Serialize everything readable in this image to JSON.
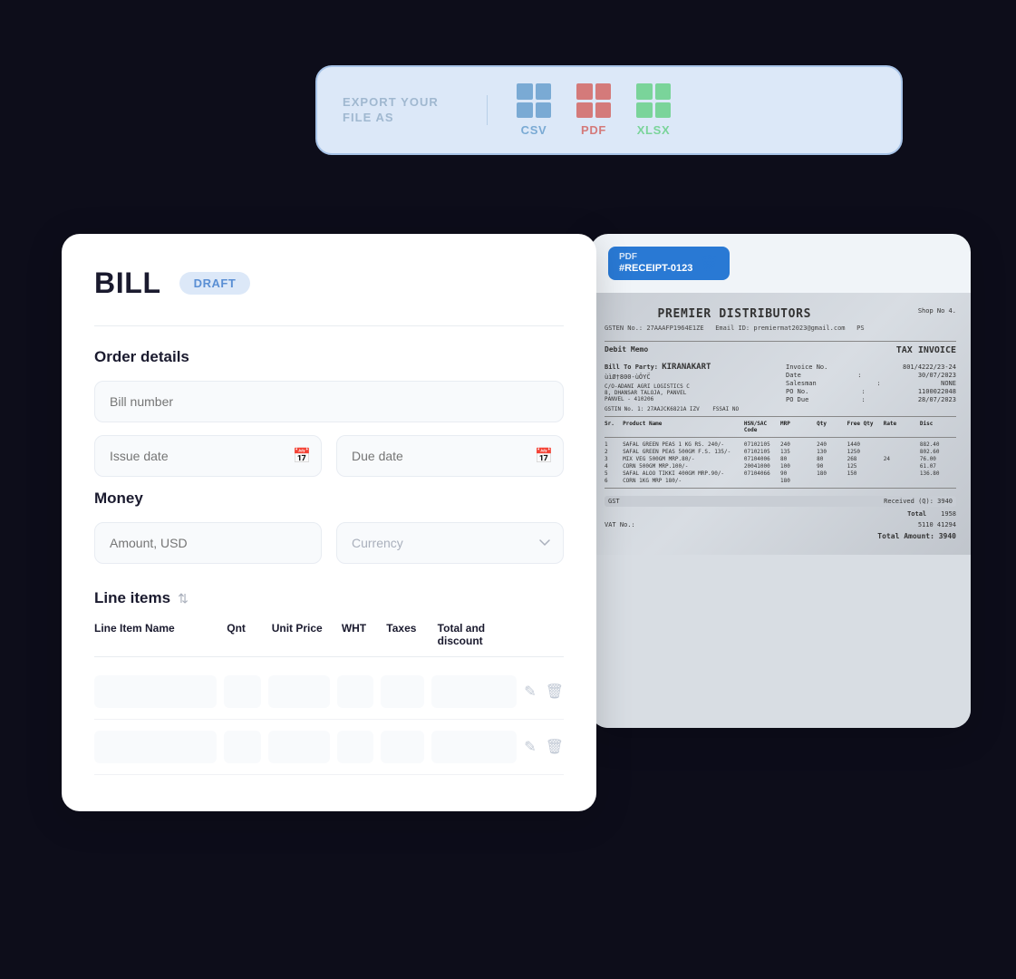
{
  "export": {
    "label": "EXPORT YOUR\nFILE AS",
    "options": [
      {
        "id": "csv",
        "label": "CSV",
        "color": "csv-color",
        "labelClass": "csv-label"
      },
      {
        "id": "pdf",
        "label": "PDF",
        "color": "pdf-color",
        "labelClass": "pdf-label"
      },
      {
        "id": "xlsx",
        "label": "XLSX",
        "color": "xlsx-color",
        "labelClass": "xlsx-label"
      }
    ]
  },
  "bill": {
    "title": "BILL",
    "status": "DRAFT",
    "sections": {
      "orderDetails": {
        "title": "Order details",
        "billNumberPlaceholder": "Bill number",
        "issueDatePlaceholder": "Issue date",
        "dueDatePlaceholder": "Due date"
      },
      "money": {
        "title": "Money",
        "amountPlaceholder": "Amount, USD",
        "currencyPlaceholder": "Currency"
      },
      "lineItems": {
        "title": "Line items",
        "columns": [
          {
            "id": "name",
            "label": "Line Item Name"
          },
          {
            "id": "qnt",
            "label": "Qnt"
          },
          {
            "id": "unitPrice",
            "label": "Unit Price"
          },
          {
            "id": "wht",
            "label": "WHT"
          },
          {
            "id": "taxes",
            "label": "Taxes"
          },
          {
            "id": "totalDiscount",
            "label": "Total and discount"
          },
          {
            "id": "actions",
            "label": ""
          }
        ]
      }
    }
  },
  "receipt": {
    "badge": {
      "type": "PDF",
      "id": "#RECEIPT-0123"
    },
    "shopName": "PREMIER DISTRIBUTORS",
    "shopNo": "Shop No 4",
    "gstin": "27AAAFP1964E1ZE",
    "email": "premiermat2023@gmail.com",
    "debitMemo": "Debit Memo",
    "taxInvoice": "TAX INVOICE",
    "billTo": "Bill To Party: KIRANAKART",
    "address1": "C/O-ADANI AGRI LOGISTICS C",
    "address2": "8, DHANSAR TALOJA, PANVEL",
    "address3": "PANVEL - 410206",
    "invoiceNo": "801/4222/23-24",
    "date": "30/07/2023",
    "salesman": "NONE",
    "poNo": "1100022048",
    "poDue": "28/07/2023",
    "gstinParty": "27AAJCK6821A IZV",
    "fssaiNo": "FSSAI NO",
    "products": [
      {
        "sr": "1",
        "name": "SAFAL GREEN PEAS 1 KG RS. 240/-",
        "hsnCode": "07102105",
        "mrp": "240",
        "qty": "240",
        "free": "1440",
        "rate": "",
        "disc": "882.40"
      },
      {
        "sr": "2",
        "name": "SAFAL GREEN PEAS 500GM F.S. 135/-",
        "hsnCode": "07102105",
        "mrp": "135",
        "qty": "130",
        "free": "1250",
        "rate": "",
        "disc": "802.60"
      },
      {
        "sr": "3",
        "name": "MIX VEG 500GM MRP.80/-",
        "hsnCode": "07104006",
        "mrp": "80",
        "qty": "80",
        "free": "268",
        "rate": "24",
        "disc": "76.00"
      },
      {
        "sr": "4",
        "name": "CORN 500GM MRP.100/-",
        "hsnCode": "20041000",
        "mrp": "100",
        "qty": "90",
        "free": "125",
        "rate": "",
        "disc": "61.07"
      },
      {
        "sr": "5",
        "name": "SAFAL ALOO TIKKI 400GM MRP.90/-",
        "hsnCode": "07104066",
        "mrp": "90",
        "qty": "180",
        "free": "150",
        "rate": "",
        "disc": "136.80"
      },
      {
        "sr": "6",
        "name": "CORN 1KG MRP 180/-",
        "hsnCode": "",
        "mrp": "180",
        "qty": "",
        "free": "",
        "rate": "",
        "disc": ""
      }
    ],
    "total": "1958",
    "vatNo": "5110 41294",
    "amount": "3940"
  },
  "icons": {
    "calendar": "📅",
    "chevronDown": "▾",
    "sortUpDown": "⇅",
    "pencil": "✏",
    "trash": "🗑",
    "trashWhite": "🗑"
  }
}
